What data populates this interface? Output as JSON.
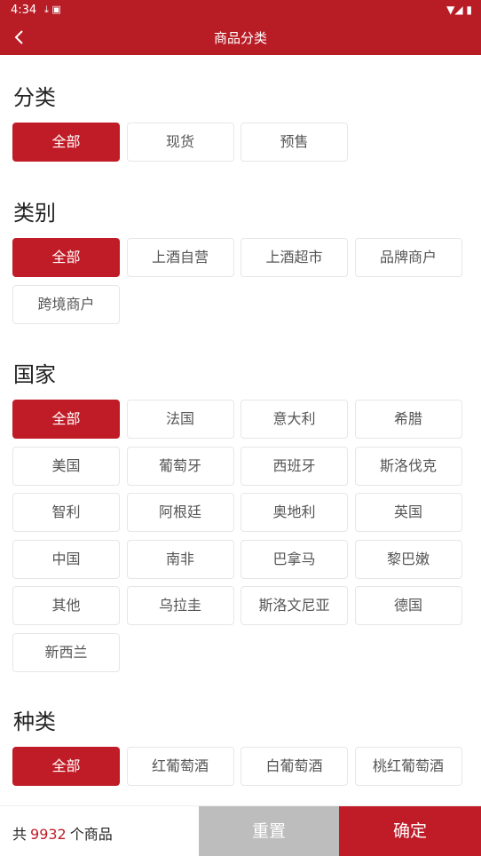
{
  "status_bar": {
    "time": "4:34"
  },
  "header": {
    "title": "商品分类"
  },
  "sections": {
    "category": {
      "title": "分类",
      "options": [
        "全部",
        "现货",
        "预售"
      ]
    },
    "type": {
      "title": "类别",
      "options": [
        "全部",
        "上酒自营",
        "上酒超市",
        "品牌商户",
        "跨境商户"
      ]
    },
    "country": {
      "title": "国家",
      "options": [
        "全部",
        "法国",
        "意大利",
        "希腊",
        "美国",
        "葡萄牙",
        "西班牙",
        "斯洛伐克",
        "智利",
        "阿根廷",
        "奥地利",
        "英国",
        "中国",
        "南非",
        "巴拿马",
        "黎巴嫩",
        "其他",
        "乌拉圭",
        "斯洛文尼亚",
        "德国",
        "新西兰"
      ]
    },
    "kind": {
      "title": "种类",
      "options": [
        "全部",
        "红葡萄酒",
        "白葡萄酒",
        "桃红葡萄酒"
      ]
    }
  },
  "footer": {
    "count_prefix": "共",
    "count": "9932",
    "count_suffix": "个商品",
    "reset_label": "重置",
    "confirm_label": "确定"
  },
  "colors": {
    "brand": "#c01c27",
    "statusbar": "#b81c25"
  }
}
